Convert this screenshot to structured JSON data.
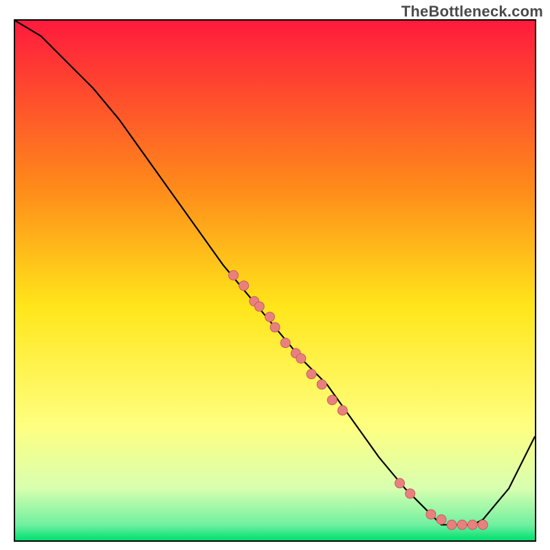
{
  "watermark": "TheBottleneck.com",
  "colors": {
    "curve": "#000000",
    "dot_fill": "#e98080",
    "dot_stroke": "#c95a5a",
    "gradient_stops": [
      {
        "offset": "0%",
        "color": "#ff1a3d"
      },
      {
        "offset": "32%",
        "color": "#ff8a1a"
      },
      {
        "offset": "55%",
        "color": "#ffe61a"
      },
      {
        "offset": "78%",
        "color": "#ffff80"
      },
      {
        "offset": "90%",
        "color": "#d8ffb0"
      },
      {
        "offset": "97%",
        "color": "#70f0a0"
      },
      {
        "offset": "100%",
        "color": "#00e070"
      }
    ]
  },
  "chart_data": {
    "type": "line",
    "title": "",
    "xlabel": "",
    "ylabel": "",
    "xlim": [
      0,
      100
    ],
    "ylim": [
      0,
      100
    ],
    "series": [
      {
        "name": "bottleneck_curve",
        "x": [
          0,
          5,
          10,
          15,
          20,
          25,
          30,
          35,
          40,
          45,
          50,
          55,
          60,
          65,
          70,
          75,
          80,
          82,
          85,
          88,
          90,
          95,
          100
        ],
        "y": [
          100,
          97,
          92,
          87,
          81,
          74,
          67,
          60,
          53,
          47,
          41,
          35,
          30,
          23,
          16,
          10,
          5,
          3,
          3,
          3,
          4,
          10,
          20
        ]
      }
    ],
    "scatter_on_curve": {
      "name": "highlighted_points",
      "x": [
        42,
        44,
        46,
        47,
        49,
        50,
        52,
        54,
        55,
        57,
        59,
        61,
        63,
        74,
        76,
        80,
        82,
        84,
        86,
        88,
        90
      ],
      "y": [
        51,
        49,
        46,
        45,
        43,
        41,
        38,
        36,
        35,
        32,
        30,
        27,
        25,
        11,
        9,
        5,
        4,
        3,
        3,
        3,
        3
      ],
      "marker_radius": 7
    }
  }
}
